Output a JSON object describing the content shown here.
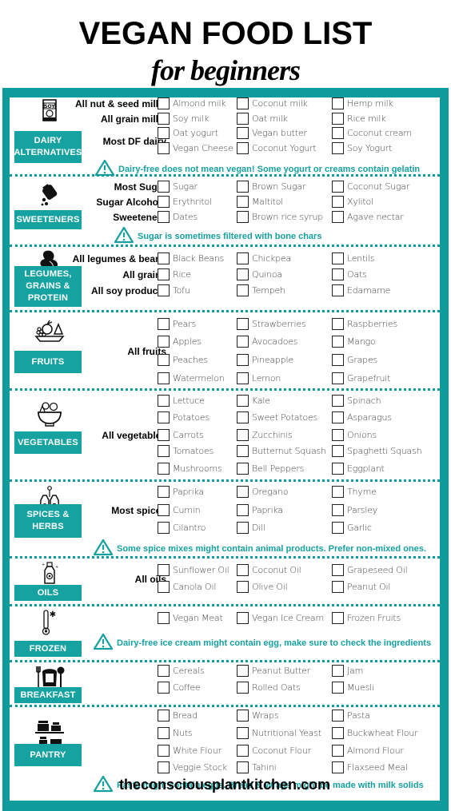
{
  "header": {
    "title": "VEGAN FOOD LIST",
    "subtitle": "for beginners"
  },
  "colors": {
    "accent": "#0f9b9b",
    "label_bg": "#17a2a2",
    "warning_text": "#16a0a0"
  },
  "sections": [
    {
      "id": "dairy",
      "label": "DAIRY ALTERNATIVES",
      "icon": "soy-milk-carton-icon",
      "row_labels": [
        "All nut & seed milks",
        "All grain milks",
        "Most DF dairy"
      ],
      "items": [
        [
          "Almond milk",
          "Coconut milk",
          "Hemp milk"
        ],
        [
          "Soy milk",
          "Oat milk",
          "Rice milk"
        ],
        [
          "Oat yogurt",
          "Vegan butter",
          "Coconut cream"
        ],
        [
          "Vegan Cheese",
          "Coconut Yogurt",
          "Soy Yogurt"
        ]
      ],
      "warning": "Dairy-free does not mean vegan! Some yogurt or creams contain gelatin"
    },
    {
      "id": "sweeteners",
      "label": "SWEETENERS",
      "icon": "sugar-pour-icon",
      "row_labels": [
        "Most Sugar",
        "Sugar Alcohols",
        "Sweeteners"
      ],
      "items": [
        [
          "Sugar",
          "Brown Sugar",
          "Coconut Sugar"
        ],
        [
          "Erythritol",
          "Maltitol",
          "Xylitol"
        ],
        [
          "Dates",
          "Brown rice syrup",
          "Agave nectar"
        ]
      ],
      "warning": "Sugar is sometimes filtered with bone chars"
    },
    {
      "id": "legumes",
      "label": "LEGUMES, GRAINS & PROTEIN",
      "icon": "bean-icon",
      "row_labels": [
        "All legumes & beans",
        "All grains",
        "All soy products"
      ],
      "items": [
        [
          "Black Beans",
          "Chickpea",
          "Lentils"
        ],
        [
          "Rice",
          "Quinoa",
          "Oats"
        ],
        [
          "Tofu",
          "Tempeh",
          "Edamame"
        ]
      ]
    },
    {
      "id": "fruits",
      "label": "FRUITS",
      "icon": "fruit-bowl-icon",
      "row_labels": [
        "All fruits"
      ],
      "items": [
        [
          "Pears",
          "Strawberries",
          "Raspberries"
        ],
        [
          "Apples",
          "Avocadoes",
          "Mango"
        ],
        [
          "Peaches",
          "Pineapple",
          "Grapes"
        ],
        [
          "Watermelon",
          "Lemon",
          "Grapefruit"
        ]
      ]
    },
    {
      "id": "vegetables",
      "label": "VEGETABLES",
      "icon": "salad-bowl-icon",
      "row_labels": [
        "All vegetables"
      ],
      "items": [
        [
          "Lettuce",
          "Kale",
          "Spinach"
        ],
        [
          "Potatoes",
          "Sweet Potatoes",
          "Asparagus"
        ],
        [
          "Carrots",
          "Zucchinis",
          "Onions"
        ],
        [
          "Tomatoes",
          "Butternut Squash",
          "Spaghetti Squash"
        ],
        [
          "Mushrooms",
          "Bell Peppers",
          "Eggplant"
        ]
      ]
    },
    {
      "id": "spices",
      "label": "SPICES & HERBS",
      "icon": "salt-pepper-icon",
      "row_labels": [
        "Most spices"
      ],
      "items": [
        [
          "Paprika",
          "Oregano",
          "Thyme"
        ],
        [
          "Cumin",
          "Paprika",
          "Parsley"
        ],
        [
          "Cilantro",
          "Dill",
          "Garlic"
        ]
      ],
      "warning": "Some spice mixes might contain animal products. Prefer non-mixed ones."
    },
    {
      "id": "oils",
      "label": "OILS",
      "icon": "oil-bottle-icon",
      "row_labels": [
        "All oils"
      ],
      "items": [
        [
          "Sunflower Oil",
          "Coconut Oil",
          "Grapeseed Oil"
        ],
        [
          "Canola Oil",
          "Olive Oil",
          "Peanut Oil"
        ]
      ]
    },
    {
      "id": "frozen",
      "label": "FROZEN",
      "icon": "thermometer-snow-icon",
      "row_labels": [],
      "items": [
        [
          "Vegan Meat",
          "Vegan Ice Cream",
          "Frozen Fruits"
        ]
      ],
      "warning": "Dairy-free ice cream might contain egg, make sure to check the ingredients"
    },
    {
      "id": "breakfast",
      "label": "BREAKFAST",
      "icon": "toast-cutlery-icon",
      "row_labels": [],
      "items": [
        [
          "Cereals",
          "Peanut Butter",
          "Jam"
        ],
        [
          "Coffee",
          "Rolled Oats",
          "Muesli"
        ]
      ]
    },
    {
      "id": "pantry",
      "label": "PANTRY",
      "icon": "jars-shelf-icon",
      "row_labels": [],
      "items": [
        [
          "Bread",
          "Wraps",
          "Pasta"
        ],
        [
          "Nuts",
          "Nutritional Yeast",
          "Buckwheat Flour"
        ],
        [
          "White Flour",
          "Coconut Flour",
          "Almond Flour"
        ],
        [
          "Veggie Stock",
          "Tahini",
          "Flaxseed Meal"
        ]
      ],
      "warning": "Pasta might contain eggs. Bread & Wraps might be made with milk solids"
    }
  ],
  "footer": {
    "website": "theconsciousplantkitchen.com"
  }
}
